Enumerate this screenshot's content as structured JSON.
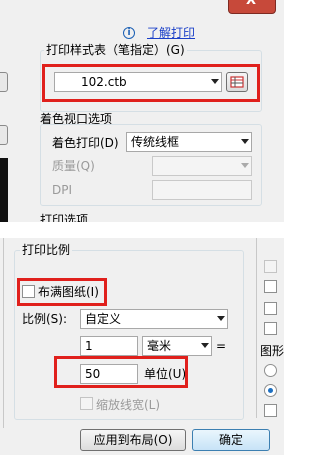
{
  "top": {
    "close_label": "X",
    "info_link": "了解打印",
    "plot_style_title": "打印样式表（笔指定）(G)",
    "plot_style_value": "102.ctb",
    "shaded_viewport_title": "着色视口选项",
    "shaded_plot_label": "着色打印(D)",
    "shaded_plot_value": "传统线框",
    "quality_label": "质量(Q)",
    "dpi_label": "DPI",
    "plot_options_title": "打印选项"
  },
  "bottom": {
    "scale_title": "打印比例",
    "fit_to_paper_label": "布满图纸(I)",
    "scale_label": "比例(S):",
    "scale_value": "自定义",
    "units_value_1": "1",
    "units_type": "毫米",
    "equals_label": "=",
    "units_value_2": "50",
    "units_label": "单位(U)",
    "scale_lineweights_label": "缩放线宽(L)",
    "drawing_orientation_label": "图形",
    "apply_to_layout_label": "应用到布局(O)",
    "ok_label": "确定"
  }
}
